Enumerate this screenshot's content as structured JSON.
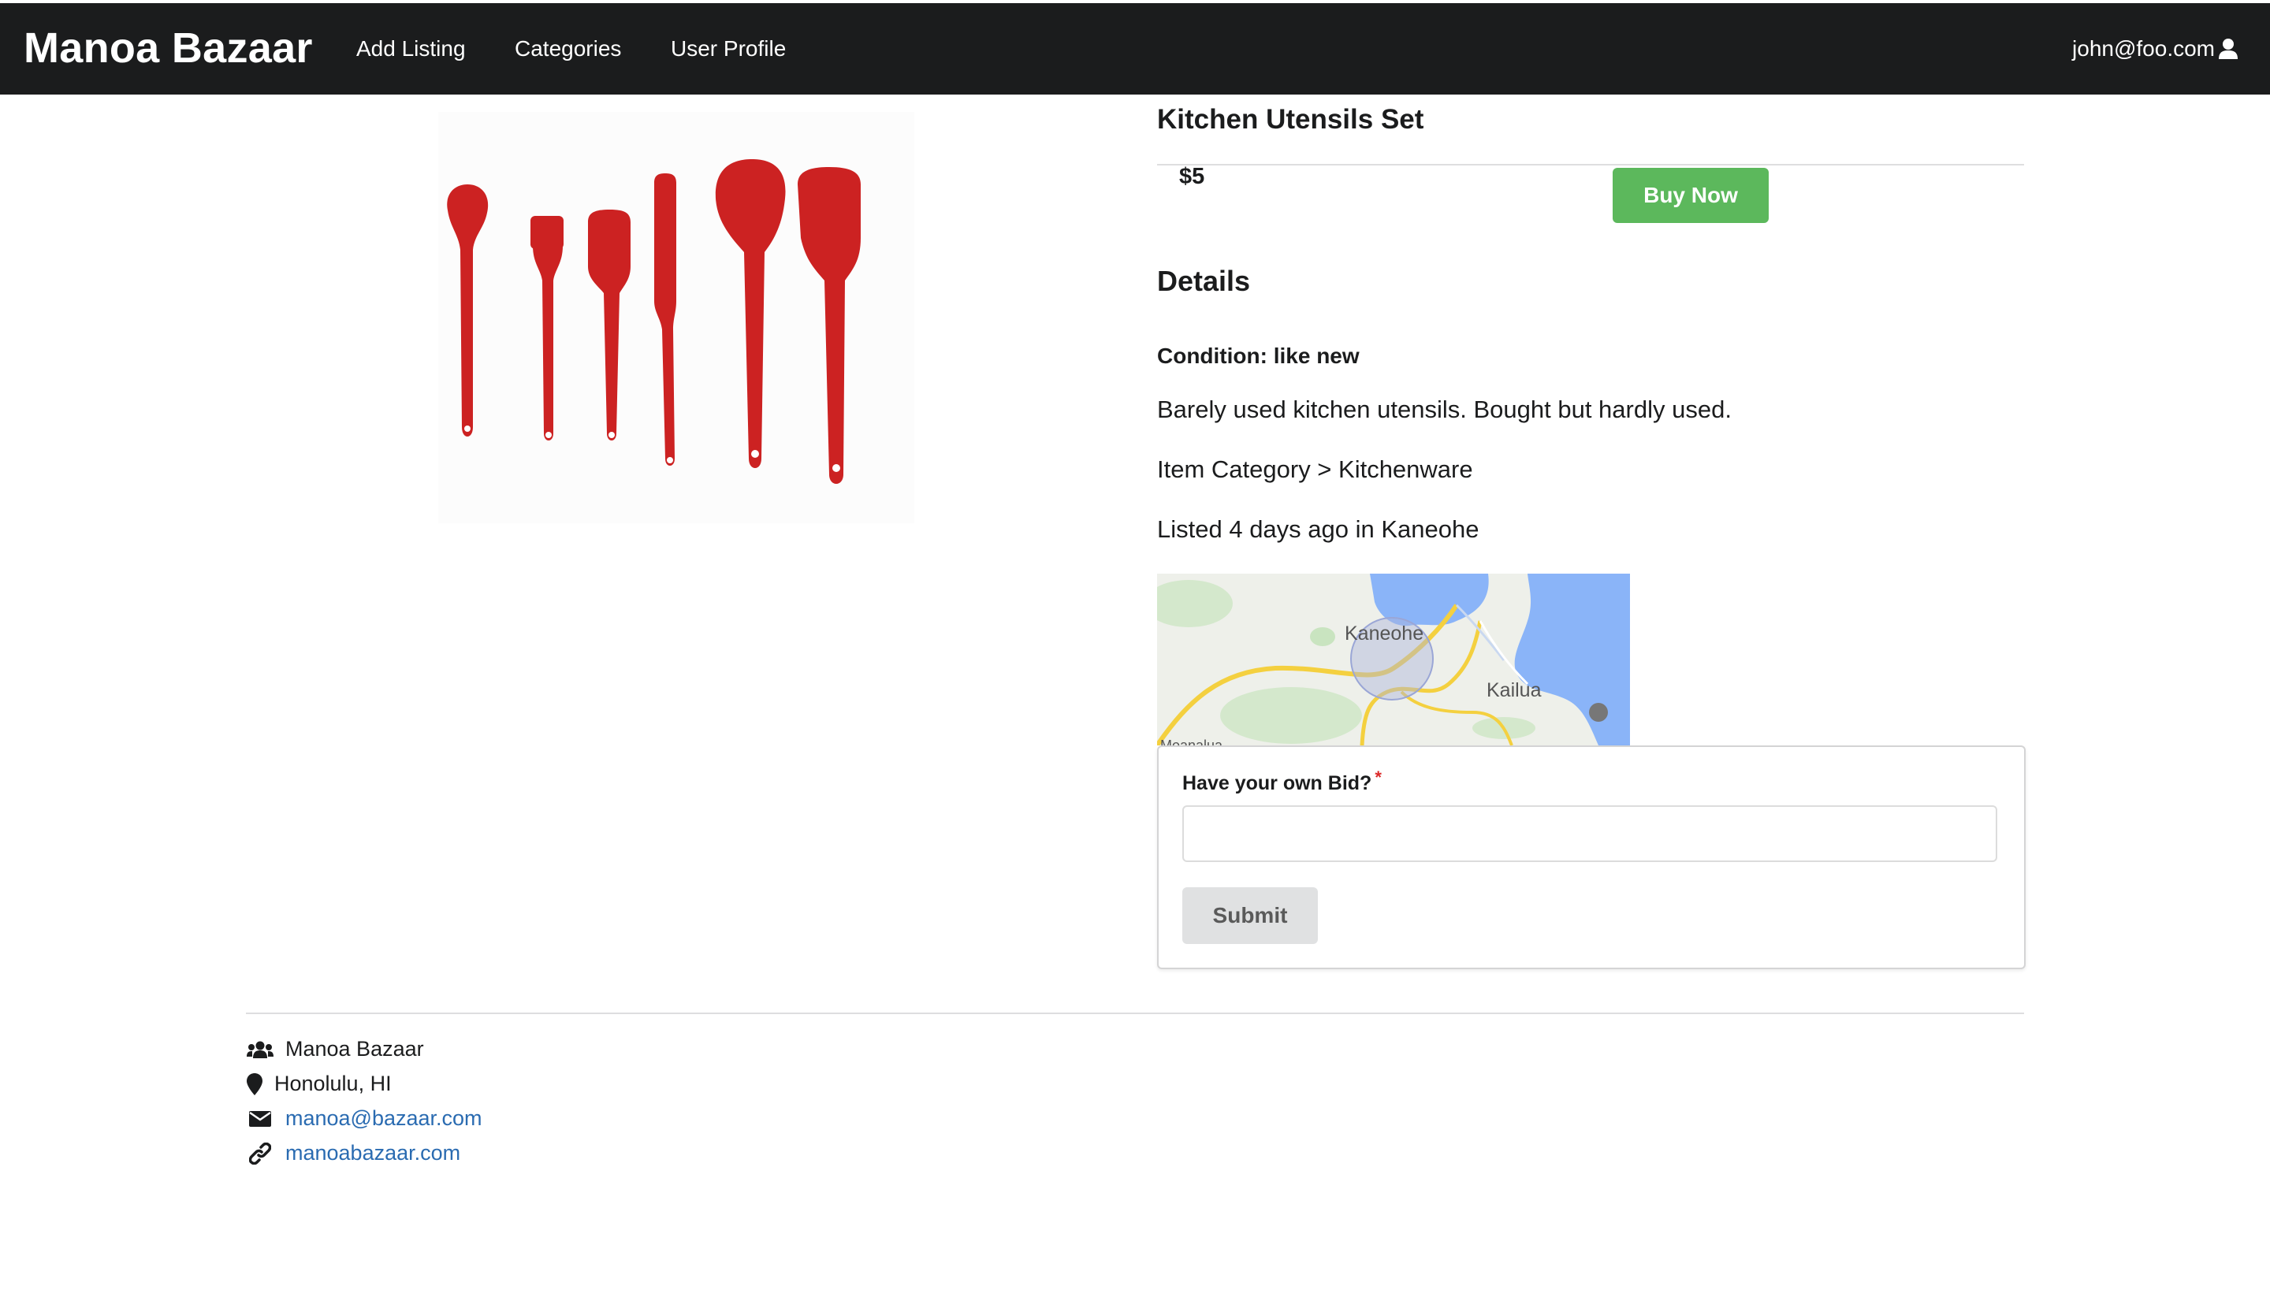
{
  "navbar": {
    "brand": "Manoa Bazaar",
    "links": [
      "Add Listing",
      "Categories",
      "User Profile"
    ],
    "user_email": "john@foo.com",
    "user_icon": "user-icon"
  },
  "listing": {
    "title": "Kitchen Utensils Set",
    "price": "$5",
    "buy_label": "Buy Now",
    "details_heading": "Details",
    "condition": "Condition: like new",
    "description": "Barely used kitchen utensils. Bought but hardly used.",
    "category": "Item Category > Kitchenware",
    "listed": "Listed 4 days ago in Kaneohe",
    "image_alt": "Six red silicone kitchen utensils"
  },
  "map": {
    "labels": [
      "Kaneohe",
      "Kailua",
      "Moanalua"
    ]
  },
  "bid_form": {
    "label": "Have your own Bid?",
    "required_mark": "*",
    "input_value": "",
    "submit_label": "Submit"
  },
  "footer": {
    "org": "Manoa Bazaar",
    "location": "Honolulu, HI",
    "email": "manoa@bazaar.com",
    "website": "manoabazaar.com"
  },
  "colors": {
    "navbar_bg": "#1b1c1d",
    "buy_button": "#5cb85c",
    "link": "#2a6bb1",
    "required": "#db2828",
    "utensil_red": "#cc2222"
  }
}
